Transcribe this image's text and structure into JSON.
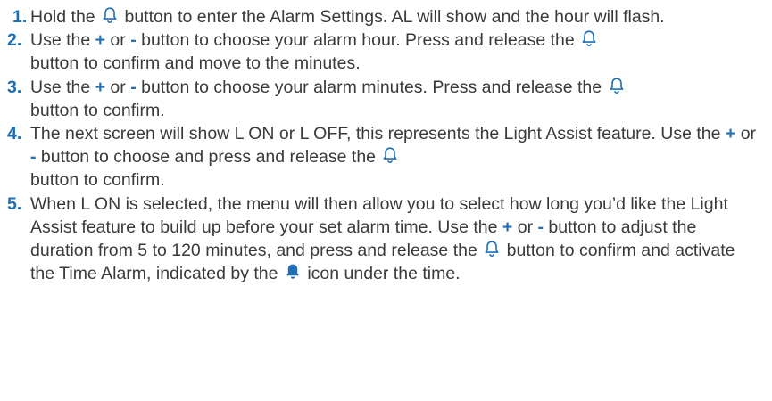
{
  "steps": [
    {
      "number": "1.",
      "parts": [
        "Hold the ",
        " button to enter the Alarm Settings. AL will show and the hour will flash."
      ]
    },
    {
      "number": "2.",
      "parts": [
        "Use the ",
        "+",
        " or ",
        "-",
        " button to choose your alarm hour. Press and release the ",
        " button to confirm and move to the minutes."
      ]
    },
    {
      "number": "3.",
      "parts": [
        "Use the ",
        "+",
        " or ",
        "-",
        " button to choose your alarm minutes. Press and release the ",
        " button to confirm."
      ]
    },
    {
      "number": "4.",
      "parts": [
        "The next screen will show L ON or L OFF, this represents the Light Assist feature. Use the ",
        "+",
        " or ",
        "-",
        " button to choose and press and release the ",
        " button to confirm."
      ]
    },
    {
      "number": "5.",
      "parts": [
        "When L ON is selected, the menu will then allow you to select how long you’d like the Light Assist feature to build up before your set alarm time. Use the ",
        "+",
        " or ",
        "-",
        " button to adjust the duration from 5 to 120 minutes, and press and release the ",
        " button to confirm and activate the Time Alarm, indicated by the ",
        " icon under the time."
      ]
    }
  ],
  "colors": {
    "accent": "#1f6fb6",
    "text": "#3a3a3a"
  },
  "icons": {
    "bell_outline": "bell-outline-icon",
    "bell_filled": "bell-filled-icon"
  }
}
